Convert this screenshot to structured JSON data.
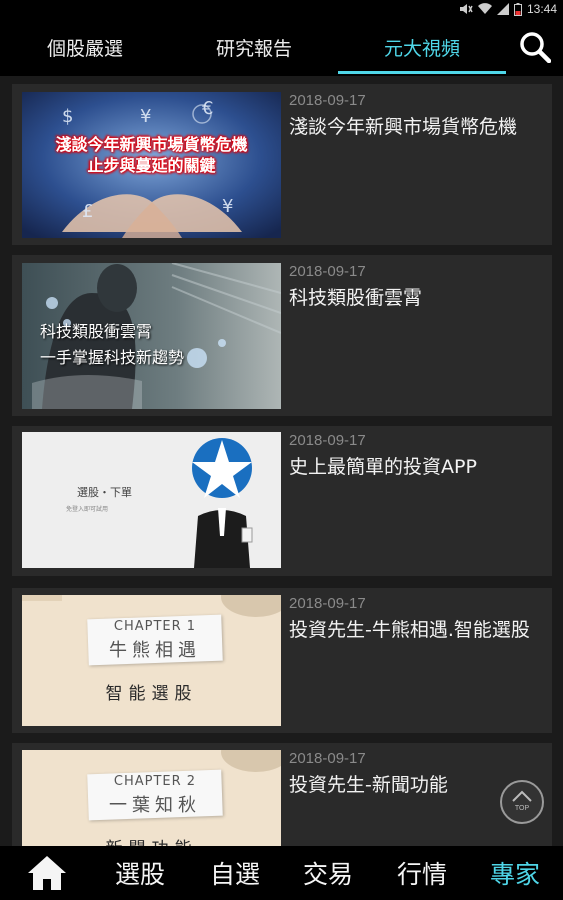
{
  "status_bar": {
    "time": "13:44"
  },
  "tabs": [
    {
      "label": "個股嚴選"
    },
    {
      "label": "研究報告"
    },
    {
      "label": "元大視頻",
      "active": true
    }
  ],
  "videos": [
    {
      "date": "2018-09-17",
      "title": "淺談今年新興市場貨幣危機",
      "thumb_text": [
        "淺談今年新興市場貨幣危機",
        "止步與蔓延的關鍵"
      ]
    },
    {
      "date": "2018-09-17",
      "title": "科技類股衝雲霄",
      "thumb_text": [
        "科技類股衝雲霄",
        "一手掌握科技新趨勢"
      ]
    },
    {
      "date": "2018-09-17",
      "title": "史上最簡單的投資APP",
      "thumb_text": [
        "選股・下單",
        "免登入即可試用"
      ]
    },
    {
      "date": "2018-09-17",
      "title": "投資先生-牛熊相遇.智能選股",
      "thumb_text": [
        "CHAPTER 1",
        "牛熊相遇",
        "智能選股"
      ]
    },
    {
      "date": "2018-09-17",
      "title": "投資先生-新聞功能",
      "thumb_text": [
        "CHAPTER 2",
        "一葉知秋",
        "新聞功能"
      ]
    }
  ],
  "top_button": {
    "label": "TOP"
  },
  "bottom_nav": [
    {
      "label": "home"
    },
    {
      "label": "選股"
    },
    {
      "label": "自選"
    },
    {
      "label": "交易"
    },
    {
      "label": "行情"
    },
    {
      "label": "專家",
      "active": true
    }
  ],
  "colors": {
    "accent": "#4fd6e8",
    "background": "#1b1b1b",
    "card": "#2a2a2a",
    "bar": "#000000"
  }
}
